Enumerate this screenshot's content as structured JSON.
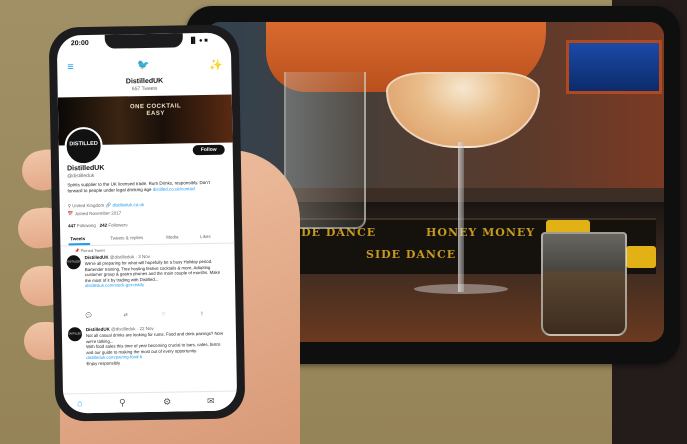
{
  "status_bar": {
    "time": "20:00",
    "signal": "▐▌ ● ■"
  },
  "nav": {
    "menu_icon": "≡",
    "logo_icon": "🐦",
    "feature_icon": "✨"
  },
  "profile": {
    "header_name": "DistilledUK",
    "header_tweets": "657 Tweets",
    "banner_text": "ONE COCKTAIL\nEASY",
    "avatar_text": "DISTILLED",
    "follow_label": "Follow",
    "name": "DistilledUK",
    "handle": "@distilleduk",
    "bio": "Spirits supplier to the UK licensed trade. Rum Drinks, responsibly. Don't forward to people under legal drinking age",
    "bio_link": "distilled.co.uk/contact",
    "location": "United Kingdom",
    "website": "distilleduk.co.uk",
    "joined": "Joined November 2017",
    "following_count": "447",
    "following_label": "Following",
    "followers_count": "242",
    "followers_label": "Followers"
  },
  "tabs": [
    "Tweets",
    "Tweets & replies",
    "Media",
    "Likes"
  ],
  "pinned_label": "Pinned Tweet",
  "tweets": [
    {
      "avatar": "DISTILLED",
      "name": "DistilledUK",
      "handle": "@distilleduk · 3 Nov",
      "body": "We're all preparing for what will hopefully be a busy Holiday period. Bartender training, Tree hosting festive cocktails & more, Adopting customer group & gastro phones and the main couple of months. Make the most of it by trading with Distilled...",
      "link": "distilleduk.com/stock-get-ready"
    },
    {
      "avatar": "DISTILLED",
      "name": "DistilledUK",
      "handle": "@distilleduk · 22 Nov",
      "body": "Not all casual drinks are looking for rums. Food and drink pairings? Now we're talking...",
      "body2": "With food sales this time of year becoming crucial to bars, cafes, bistro and our guide to making the most out of every opportunity.",
      "link": "distilleduk.com/pairing-food-b",
      "footer": "Enjoy responsibly"
    }
  ],
  "tablet_scene": {
    "mat_text_1": "SIDE DANCE",
    "mat_text_2": "HONEY MONEY"
  },
  "colors": {
    "twitter_blue": "#1d9bf0",
    "olive_bg": "#9a8b61",
    "dark_bg": "#231c1b"
  }
}
